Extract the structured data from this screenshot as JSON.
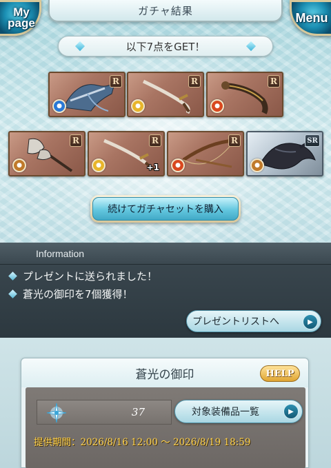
{
  "header": {
    "title": "ガチャ結果",
    "mypage_label_line1": "My",
    "mypage_label_line2": "page",
    "menu_label": "Menu"
  },
  "result": {
    "banner": "以下7点をGET！",
    "items": [
      {
        "rarity": "R",
        "element": "water",
        "plus": ""
      },
      {
        "rarity": "R",
        "element": "light",
        "plus": ""
      },
      {
        "rarity": "R",
        "element": "fire",
        "plus": ""
      },
      {
        "rarity": "R",
        "element": "earth",
        "plus": ""
      },
      {
        "rarity": "R",
        "element": "light",
        "plus": "+1"
      },
      {
        "rarity": "R",
        "element": "fire",
        "plus": ""
      },
      {
        "rarity": "SR",
        "element": "earth",
        "plus": ""
      }
    ],
    "continue_label": "続けてガチャセットを購入"
  },
  "info": {
    "heading": "Information",
    "messages": [
      "プレゼントに送られました！",
      "蒼光の御印を7個獲得！"
    ],
    "present_button": "プレゼントリストへ"
  },
  "seal": {
    "title": "蒼光の御印",
    "help_label": "HELP",
    "count": "37",
    "equip_button": "対象装備品一覧",
    "period": "提供期間：2026/8/16 12:00 〜 2026/8/19 18:59"
  },
  "colors": {
    "water": "#2a79d6",
    "light": "#e8b52a",
    "fire": "#d9481f",
    "earth": "#c07a2a"
  }
}
